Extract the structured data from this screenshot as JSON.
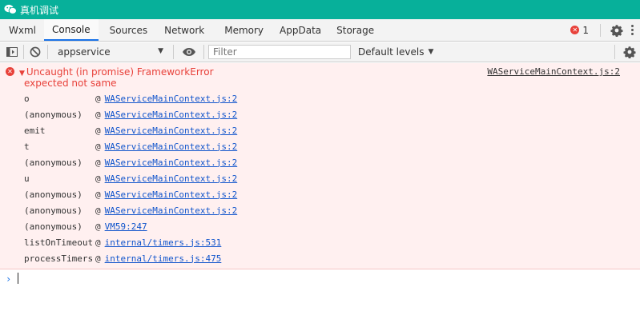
{
  "window": {
    "title": "真机调试"
  },
  "tabs": [
    {
      "label": "Wxml",
      "active": false
    },
    {
      "label": "Console",
      "active": true
    },
    {
      "label": "Sources",
      "active": false
    },
    {
      "label": "Network",
      "active": false
    },
    {
      "label": "Memory",
      "active": false
    },
    {
      "label": "AppData",
      "active": false
    },
    {
      "label": "Storage",
      "active": false
    }
  ],
  "status": {
    "error_count": "1"
  },
  "toolbar": {
    "context": "appservice",
    "filter_placeholder": "Filter",
    "filter_value": "",
    "levels": "Default levels"
  },
  "error": {
    "message": "Uncaught (in promise) FrameworkError",
    "detail": "expected not same",
    "source": "WAServiceMainContext.js:2",
    "stack": [
      {
        "fn": "o",
        "loc": "WAServiceMainContext.js:2"
      },
      {
        "fn": "(anonymous)",
        "loc": "WAServiceMainContext.js:2"
      },
      {
        "fn": "emit",
        "loc": "WAServiceMainContext.js:2"
      },
      {
        "fn": "t",
        "loc": "WAServiceMainContext.js:2"
      },
      {
        "fn": "(anonymous)",
        "loc": "WAServiceMainContext.js:2"
      },
      {
        "fn": "u",
        "loc": "WAServiceMainContext.js:2"
      },
      {
        "fn": "(anonymous)",
        "loc": "WAServiceMainContext.js:2"
      },
      {
        "fn": "(anonymous)",
        "loc": "WAServiceMainContext.js:2"
      },
      {
        "fn": "(anonymous)",
        "loc": "VM59:247"
      },
      {
        "fn": "listOnTimeout",
        "loc": "internal/timers.js:531"
      },
      {
        "fn": "processTimers",
        "loc": "internal/timers.js:475"
      }
    ]
  },
  "colors": {
    "titlebar": "#07b09a",
    "error_text": "#e8413a",
    "error_bg": "#fff0f0",
    "link": "#1155cc",
    "accent": "#1a73e8"
  },
  "icons": {
    "app": "wechat-icon",
    "error": "error-circle-icon",
    "settings": "gear-icon",
    "more": "kebab-menu-icon",
    "sidebar": "sidebar-toggle-icon",
    "clear": "clear-console-icon",
    "eye": "eye-icon",
    "prompt": "chevron-right-icon"
  }
}
